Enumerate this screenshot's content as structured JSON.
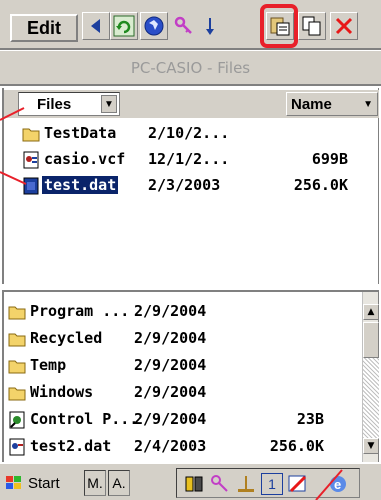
{
  "toolbar": {
    "edit_label": "Edit",
    "buttons": [
      "back-icon",
      "refresh-icon",
      "globe-icon",
      "key-icon",
      "sort-icon",
      "paste-icon",
      "copy-icon",
      "delete-icon"
    ]
  },
  "window": {
    "title": "PC-CASIO - Files"
  },
  "top_pane": {
    "folder_selector": "Files",
    "sort_column": "Name",
    "rows": [
      {
        "name": "TestData",
        "date": "2/10/2...",
        "size": "",
        "icon": "folder-icon"
      },
      {
        "name": "casio.vcf",
        "date": "12/1/2...",
        "size": "699B",
        "icon": "contact-file-icon"
      },
      {
        "name": "test.dat",
        "date": "2/3/2003",
        "size": "256.0K",
        "icon": "data-file-icon",
        "selected": true
      }
    ]
  },
  "bottom_pane": {
    "rows": [
      {
        "name": "Program ...",
        "date": "2/9/2004",
        "size": "",
        "icon": "folder-icon"
      },
      {
        "name": "Recycled",
        "date": "2/9/2004",
        "size": "",
        "icon": "folder-icon"
      },
      {
        "name": "Temp",
        "date": "2/9/2004",
        "size": "",
        "icon": "folder-icon"
      },
      {
        "name": "Windows",
        "date": "2/9/2004",
        "size": "",
        "icon": "folder-icon"
      },
      {
        "name": "Control P...",
        "date": "2/9/2004",
        "size": "23B",
        "icon": "shortcut-icon"
      },
      {
        "name": "test2.dat",
        "date": "2/4/2003",
        "size": "256.0K",
        "icon": "data-file-icon"
      }
    ]
  },
  "taskbar": {
    "start_label": "Start",
    "tasks": [
      "M.",
      "A."
    ],
    "tray_icons": [
      "battery-icon",
      "key-icon",
      "usb-icon",
      "input-panel-icon",
      "edit-icon",
      "ie-icon"
    ],
    "tray_input_label": "1"
  },
  "colors": {
    "selection": "#0a246a",
    "highlight": "#e8202a",
    "chrome": "#d4d0c8"
  }
}
